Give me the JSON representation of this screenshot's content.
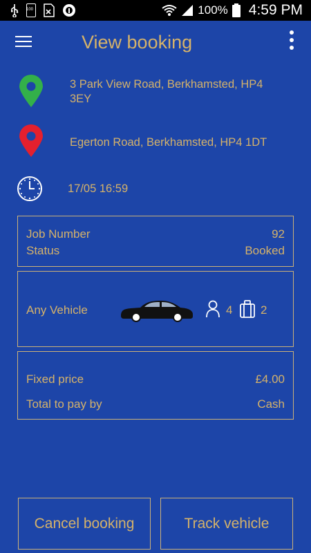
{
  "status_bar": {
    "battery_level_label": "100",
    "signal_percent": "100%",
    "time": "4:59 PM"
  },
  "header": {
    "title": "View booking"
  },
  "pickup": {
    "address": "3 Park View Road, Berkhamsted, HP4 3EY",
    "pin_color": "#33b04a"
  },
  "dropoff": {
    "address": "Egerton Road, Berkhamsted, HP4 1DT",
    "pin_color": "#e4202e"
  },
  "datetime": {
    "value": "17/05 16:59"
  },
  "job_card": {
    "job_number_label": "Job Number",
    "job_number_value": "92",
    "status_label": "Status",
    "status_value": "Booked"
  },
  "vehicle_card": {
    "vehicle_label": "Any Vehicle",
    "passengers": "4",
    "luggage": "2"
  },
  "price_card": {
    "price_label": "Fixed price",
    "price_value": "£4.00",
    "payment_label": "Total to pay by",
    "payment_value": "Cash"
  },
  "actions": {
    "cancel_label": "Cancel booking",
    "track_label": "Track vehicle"
  },
  "colors": {
    "background": "#1d45a8",
    "accent": "#d5b26a"
  }
}
